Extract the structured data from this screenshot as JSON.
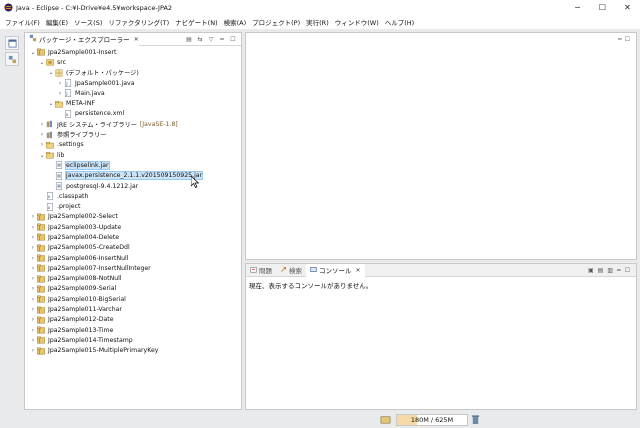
{
  "window": {
    "title": "Java - Eclipse - C:¥I-Drive¥e4.5¥workspace-JPA2"
  },
  "menu": [
    "ファイル(F)",
    "編集(E)",
    "ソース(S)",
    "リファクタリング(T)",
    "ナビゲート(N)",
    "検索(A)",
    "プロジェクト(P)",
    "実行(R)",
    "ウィンドウ(W)",
    "ヘルプ(H)"
  ],
  "explorer": {
    "tab_label": "パッケージ・エクスプローラー",
    "tree": [
      {
        "label": "Jpa2Sample001-Insert",
        "icon": "project-icon",
        "indent": 0,
        "twisty": "open"
      },
      {
        "label": "src",
        "icon": "source-folder-icon",
        "indent": 1,
        "twisty": "open"
      },
      {
        "label": "(デフォルト・パッケージ)",
        "icon": "package-icon",
        "indent": 2,
        "twisty": "open"
      },
      {
        "label": "JpaSample001.java",
        "icon": "java-file-icon",
        "indent": 3,
        "twisty": "closed"
      },
      {
        "label": "Main.java",
        "icon": "java-file-icon",
        "indent": 3,
        "twisty": "closed"
      },
      {
        "label": "META-INF",
        "icon": "folder-icon",
        "indent": 2,
        "twisty": "open"
      },
      {
        "label": "persistence.xml",
        "icon": "xml-file-icon",
        "indent": 3,
        "twisty": ""
      },
      {
        "label": "JRE システム・ライブラリー",
        "decor": "[JavaSE-1.8]",
        "icon": "library-icon",
        "indent": 1,
        "twisty": "closed"
      },
      {
        "label": "参照ライブラリー",
        "icon": "library-icon",
        "indent": 1,
        "twisty": "closed"
      },
      {
        "label": ".settings",
        "icon": "folder-icon",
        "indent": 1,
        "twisty": "closed"
      },
      {
        "label": "lib",
        "icon": "folder-icon",
        "indent": 1,
        "twisty": "open"
      },
      {
        "label": "eclipselink.jar",
        "icon": "jar-icon",
        "indent": 2,
        "twisty": "",
        "selected": true
      },
      {
        "label": "javax.persistence_2.1.1.v201509150925.jar",
        "icon": "jar-icon",
        "indent": 2,
        "twisty": "",
        "selected": true
      },
      {
        "label": "postgresql-9.4.1212.jar",
        "icon": "jar-icon",
        "indent": 2,
        "twisty": ""
      },
      {
        "label": ".classpath",
        "icon": "xml-file-icon",
        "indent": 1,
        "twisty": ""
      },
      {
        "label": ".project",
        "icon": "xml-file-icon",
        "indent": 1,
        "twisty": ""
      },
      {
        "label": "Jpa2Sample002-Select",
        "icon": "project-icon",
        "indent": 0,
        "twisty": "closed"
      },
      {
        "label": "Jpa2Sample003-Update",
        "icon": "project-icon",
        "indent": 0,
        "twisty": "closed"
      },
      {
        "label": "Jpa2Sample004-Delete",
        "icon": "project-icon",
        "indent": 0,
        "twisty": "closed"
      },
      {
        "label": "Jpa2Sample005-CreateDdl",
        "icon": "project-icon",
        "indent": 0,
        "twisty": "closed"
      },
      {
        "label": "Jpa2Sample006-InsertNull",
        "icon": "project-icon",
        "indent": 0,
        "twisty": "closed"
      },
      {
        "label": "Jpa2Sample007-InsertNullInteger",
        "icon": "project-icon",
        "indent": 0,
        "twisty": "closed"
      },
      {
        "label": "Jpa2Sample008-NotNull",
        "icon": "project-icon",
        "indent": 0,
        "twisty": "closed"
      },
      {
        "label": "Jpa2Sample009-Serial",
        "icon": "project-icon",
        "indent": 0,
        "twisty": "closed"
      },
      {
        "label": "Jpa2Sample010-BigSerial",
        "icon": "project-icon",
        "indent": 0,
        "twisty": "closed"
      },
      {
        "label": "Jpa2Sample011-Varchar",
        "icon": "project-icon",
        "indent": 0,
        "twisty": "closed"
      },
      {
        "label": "Jpa2Sample012-Date",
        "icon": "project-icon",
        "indent": 0,
        "twisty": "closed"
      },
      {
        "label": "Jpa2Sample013-Time",
        "icon": "project-icon",
        "indent": 0,
        "twisty": "closed"
      },
      {
        "label": "Jpa2Sample014-Timestamp",
        "icon": "project-icon",
        "indent": 0,
        "twisty": "closed"
      },
      {
        "label": "Jpa2Sample015-MultiplePrimaryKey",
        "icon": "project-icon",
        "indent": 0,
        "twisty": "closed"
      }
    ]
  },
  "console": {
    "tabs": [
      {
        "label": "問題",
        "icon": "problems-icon"
      },
      {
        "label": "検索",
        "icon": "search-icon"
      },
      {
        "label": "コンソール",
        "icon": "console-icon",
        "active": true
      }
    ],
    "message": "現在、表示するコンソールがありません。"
  },
  "status": {
    "heap_text": "180M / 625M",
    "heap_fraction": 0.29
  },
  "colors": {
    "selection": "#cce4f7",
    "heap_fill": "#f7d9a8"
  }
}
